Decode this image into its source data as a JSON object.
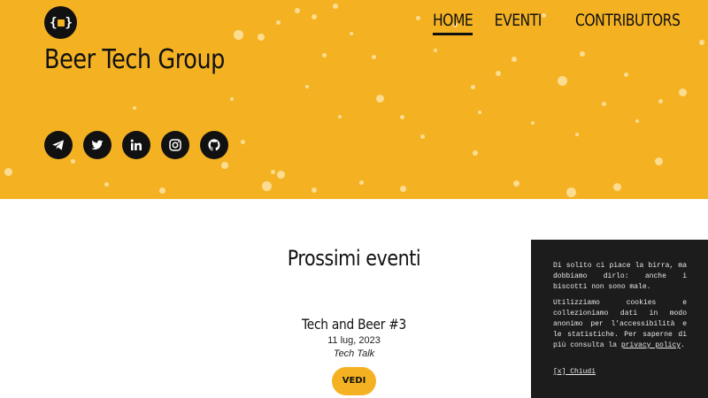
{
  "header": {
    "logo_text_left": "{",
    "logo_text_right": "}",
    "site_title": "Beer Tech Group",
    "background_color": "#f4b223"
  },
  "nav": {
    "items": [
      {
        "label": "HOME",
        "active": true
      },
      {
        "label": "EVENTI",
        "active": false
      },
      {
        "label": "CONTRIBUTORS",
        "active": false
      }
    ]
  },
  "socials": [
    {
      "icon": "telegram-icon"
    },
    {
      "icon": "twitter-icon"
    },
    {
      "icon": "linkedin-icon"
    },
    {
      "icon": "instagram-icon"
    },
    {
      "icon": "github-icon"
    }
  ],
  "main": {
    "section_title": "Prossimi eventi",
    "event": {
      "title": "Tech and Beer #3",
      "date": "11 lug, 2023",
      "type": "Tech Talk",
      "button_label": "VEDI"
    }
  },
  "cookie_banner": {
    "text1": "Di solito ci piace la birra, ma dobbiamo dirlo: anche i biscotti non sono male.",
    "text2_before": "Utilizziamo cookies e collezioniamo dati in modo anonimo per l'accessibilità e le statistiche. Per saperne di più consulta la ",
    "link_label": "privacy policy",
    "text2_after": ".",
    "close_label": "[x] Chiudi"
  }
}
